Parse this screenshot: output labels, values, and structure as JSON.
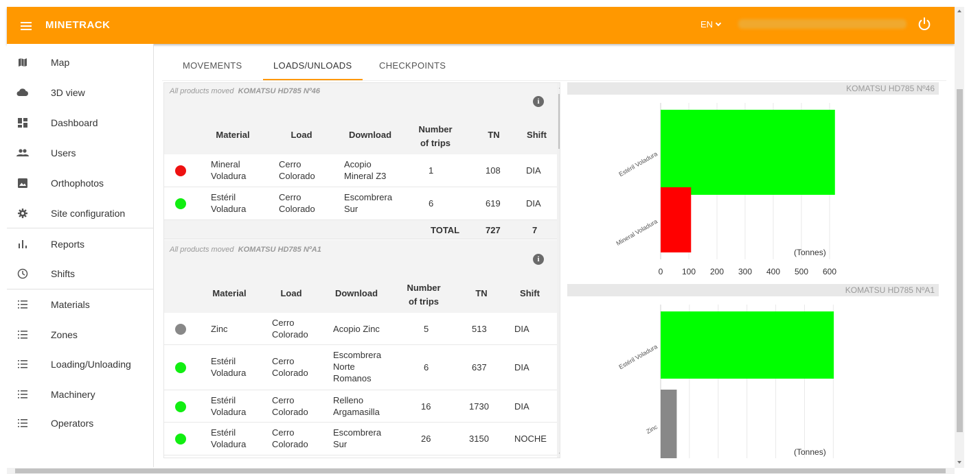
{
  "app": {
    "brand": "MINETRACK",
    "language": "EN"
  },
  "sidebar": {
    "items": [
      {
        "label": "Map",
        "icon": "map-icon"
      },
      {
        "label": "3D view",
        "icon": "cloud-icon"
      },
      {
        "label": "Dashboard",
        "icon": "dashboard-icon"
      },
      {
        "label": "Users",
        "icon": "users-icon"
      },
      {
        "label": "Orthophotos",
        "icon": "image-icon"
      },
      {
        "label": "Site configuration",
        "icon": "gear-icon"
      },
      {
        "label": "Reports",
        "icon": "bar-chart-icon"
      },
      {
        "label": "Shifts",
        "icon": "clock-icon"
      },
      {
        "label": "Materials",
        "icon": "list-icon"
      },
      {
        "label": "Zones",
        "icon": "list-icon"
      },
      {
        "label": "Loading/Unloading",
        "icon": "list-icon"
      },
      {
        "label": "Machinery",
        "icon": "list-icon"
      },
      {
        "label": "Operators",
        "icon": "list-icon"
      }
    ]
  },
  "tabs": [
    {
      "label": "MOVEMENTS",
      "active": false
    },
    {
      "label": "LOADS/UNLOADS",
      "active": true
    },
    {
      "label": "CHECKPOINTS",
      "active": false
    }
  ],
  "columns": {
    "material": "Material",
    "load": "Load",
    "download": "Download",
    "trips": "Number of trips",
    "tn": "TN",
    "shift": "Shift"
  },
  "sections": [
    {
      "title_prefix": "All products moved",
      "machine": "KOMATSU HD785 Nº46",
      "rows": [
        {
          "color": "#ee1111",
          "material": "Mineral Voladura",
          "load": "Cerro Colorado",
          "download": "Acopio Mineral Z3",
          "trips": "1",
          "tn": "108",
          "shift": "DIA"
        },
        {
          "color": "#11ee11",
          "material": "Estéril Voladura",
          "load": "Cerro Colorado",
          "download": "Escombrera Sur",
          "trips": "6",
          "tn": "619",
          "shift": "DIA"
        }
      ],
      "total": {
        "label": "TOTAL",
        "tn": "727",
        "trips": "7"
      }
    },
    {
      "title_prefix": "All products moved",
      "machine": "KOMATSU HD785 NºA1",
      "rows": [
        {
          "color": "#888888",
          "material": "Zinc",
          "load": "Cerro Colorado",
          "download": "Acopio Zinc",
          "trips": "5",
          "tn": "513",
          "shift": "DIA"
        },
        {
          "color": "#11ee11",
          "material": "Estéril Voladura",
          "load": "Cerro Colorado",
          "download": "Escombrera Norte Romanos",
          "trips": "6",
          "tn": "637",
          "shift": "DIA"
        },
        {
          "color": "#11ee11",
          "material": "Estéril Voladura",
          "load": "Cerro Colorado",
          "download": "Relleno Argamasilla",
          "trips": "16",
          "tn": "1730",
          "shift": "DIA"
        },
        {
          "color": "#11ee11",
          "material": "Estéril Voladura",
          "load": "Cerro Colorado",
          "download": "Escombrera Sur",
          "trips": "26",
          "tn": "3150",
          "shift": "NOCHE"
        }
      ]
    }
  ],
  "chart_data": [
    {
      "type": "bar",
      "orientation": "horizontal",
      "title": "KOMATSU HD785 Nº46",
      "categories": [
        "Estéril Voladura",
        "Mineral Voladura"
      ],
      "values": [
        619,
        108
      ],
      "colors": [
        "#00ff00",
        "#ff0000"
      ],
      "xlabel": "(Tonnes)",
      "xlim": [
        0,
        600
      ],
      "ticks": [
        "0",
        "100",
        "200",
        "300",
        "400",
        "500",
        "600"
      ],
      "grid": true
    },
    {
      "type": "bar",
      "orientation": "horizontal",
      "title": "KOMATSU HD785 NºA1",
      "categories": [
        "Estéril Voladura",
        "Zinc"
      ],
      "values": [
        5517,
        513
      ],
      "colors": [
        "#00ff00",
        "#888888"
      ],
      "xlabel": "(Tonnes)",
      "grid": true
    }
  ]
}
